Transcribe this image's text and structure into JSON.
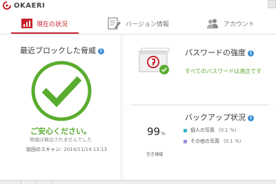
{
  "app": {
    "name": "OKAERI",
    "accent": "#c8202c"
  },
  "tabs": [
    {
      "label": "現在の状況",
      "icon": "bar-chart-icon",
      "active": true
    },
    {
      "label": "バージョン情報",
      "icon": "document-pencil-icon",
      "active": false
    },
    {
      "label": "アカウント",
      "icon": "users-icon",
      "active": false
    }
  ],
  "threats": {
    "title": "最近ブロックした脅威",
    "status": "ご安心ください。",
    "detail": "脅威は検出されませんでした",
    "last_scan_label": "前回のスキャン:",
    "last_scan_value": "2014/11/14 13:13",
    "status_color": "#5aac2e"
  },
  "password": {
    "title": "パスワードの強度",
    "status": "すべてのパスワードは適正です"
  },
  "backup": {
    "title": "バックアップ状況",
    "free_percent": "99",
    "percent_sign": "%",
    "free_label": "空き領域",
    "items": [
      {
        "label": "個人の写真",
        "value": "(0.1 %)",
        "color": "#39b5c8"
      },
      {
        "label": "その他の写真",
        "value": "(0.1 %)",
        "color": "#8f8fd8"
      }
    ]
  }
}
